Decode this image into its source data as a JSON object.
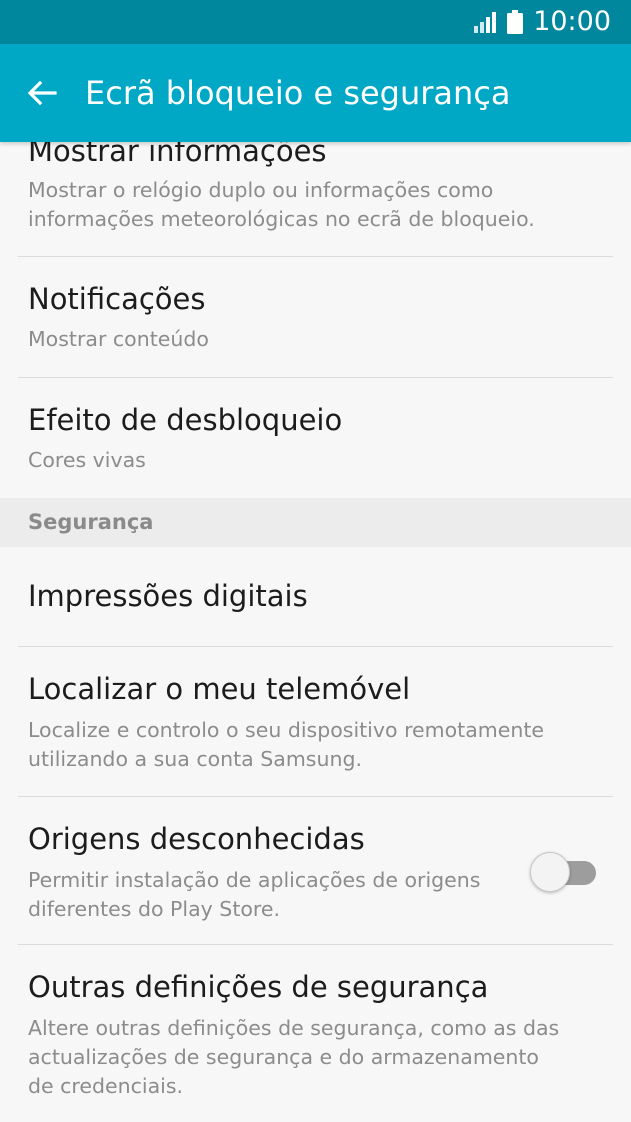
{
  "status_bar": {
    "time": "10:00",
    "icons": [
      "signal-icon",
      "battery-icon"
    ]
  },
  "app_bar": {
    "title": "Ecrã bloqueio e segurança",
    "back_icon": "back-arrow-icon"
  },
  "items": [
    {
      "title": "Mostrar informações",
      "subtitle_lines": [
        "Mostrar o relógio duplo ou informações como",
        "informações meteorológicas no ecrã de bloqueio."
      ]
    },
    {
      "title": "Notificações",
      "subtitle_lines": [
        "Mostrar conteúdo"
      ]
    },
    {
      "title": "Efeito de desbloqueio",
      "subtitle_lines": [
        "Cores vivas"
      ]
    }
  ],
  "security_section": {
    "header": "Segurança",
    "items": [
      {
        "title": "Impressões digitais"
      },
      {
        "title": "Localizar o meu telemóvel",
        "subtitle_lines": [
          "Localize e controlo o seu dispositivo remotamente",
          "utilizando a sua conta Samsung."
        ]
      },
      {
        "title": "Origens desconhecidas",
        "subtitle_lines": [
          "Permitir instalação de aplicações de origens",
          "diferentes do Play Store."
        ],
        "toggle_on": false
      },
      {
        "title": "Outras definições de segurança",
        "subtitle_lines": [
          "Altere outras definições de segurança, como as das",
          "actualizações de segurança e do armazenamento",
          "de credenciais."
        ]
      }
    ]
  },
  "colors": {
    "status_bar": "#00869d",
    "app_bar": "#00a8c6",
    "background": "#f7f7f7",
    "section_header_bg": "#ececec"
  }
}
